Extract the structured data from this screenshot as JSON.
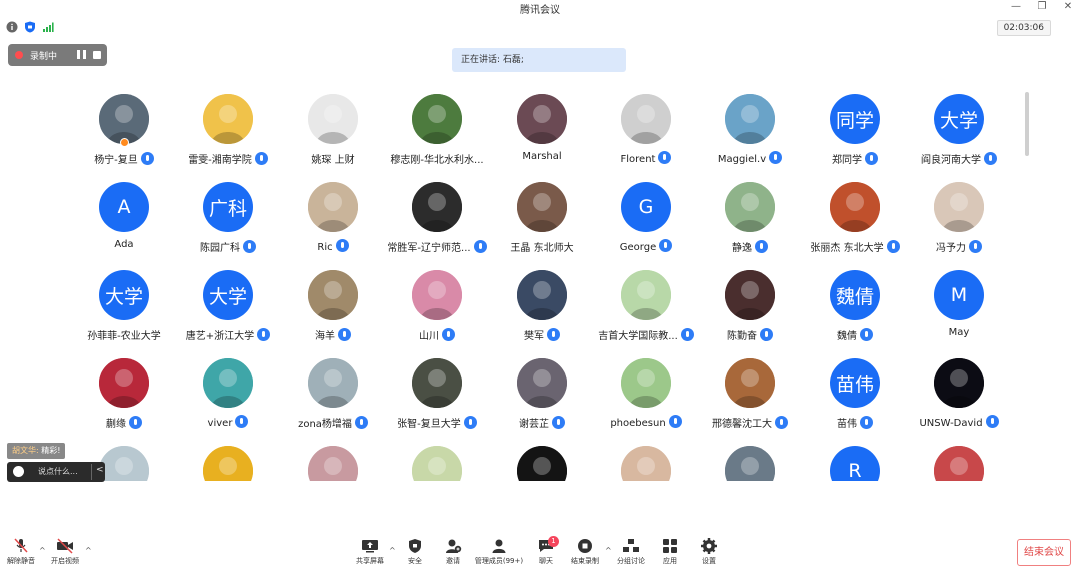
{
  "window": {
    "title": "腾讯会议"
  },
  "status": {
    "timer": "02:03:06"
  },
  "recording": {
    "label": "录制中"
  },
  "speaking": {
    "text": "正在讲话: 石磊;"
  },
  "participants": [
    {
      "name": "杨宁-复旦",
      "type": "photo",
      "color": "#5a6a78",
      "mic": true,
      "host": true
    },
    {
      "name": "雷雯-湘南学院",
      "type": "photo",
      "color": "#f0c24a",
      "mic": true
    },
    {
      "name": "姚琛 上财",
      "type": "photo",
      "color": "#e8e8e8",
      "mic": false
    },
    {
      "name": "穆志刚-华北水利水...",
      "type": "photo",
      "color": "#4d7b3e",
      "mic": false
    },
    {
      "name": "Marshal",
      "type": "photo",
      "color": "#6b4a54",
      "mic": false
    },
    {
      "name": "Florent",
      "type": "photo",
      "color": "#cfcfcf",
      "mic": true
    },
    {
      "name": "Maggiel.v",
      "type": "photo",
      "color": "#6aa3c8",
      "mic": true
    },
    {
      "name": "郑同学",
      "type": "initials",
      "initials": "同学",
      "mic": true
    },
    {
      "name": "阎良河南大学",
      "type": "initials",
      "initials": "大学",
      "mic": true
    },
    {
      "name": "Ada",
      "type": "initials",
      "initials": "A",
      "mic": false
    },
    {
      "name": "陈园广科",
      "type": "initials",
      "initials": "广科",
      "mic": true
    },
    {
      "name": "Ric",
      "type": "photo",
      "color": "#c9b49a",
      "mic": true
    },
    {
      "name": "常胜军-辽宁师范...",
      "type": "photo",
      "color": "#2c2c2c",
      "mic": true
    },
    {
      "name": "王晶 东北师大",
      "type": "photo",
      "color": "#7a5a4a",
      "mic": false
    },
    {
      "name": "George",
      "type": "initials",
      "initials": "G",
      "mic": true
    },
    {
      "name": "静逸",
      "type": "photo",
      "color": "#8fb38a",
      "mic": true
    },
    {
      "name": "张丽杰 东北大学",
      "type": "photo",
      "color": "#c0502c",
      "mic": true
    },
    {
      "name": "冯予力",
      "type": "photo",
      "color": "#d9c7b8",
      "mic": true
    },
    {
      "name": "孙菲菲-农业大学",
      "type": "initials",
      "initials": "大学",
      "mic": false
    },
    {
      "name": "唐艺+浙江大学",
      "type": "initials",
      "initials": "大学",
      "mic": true
    },
    {
      "name": "海羊",
      "type": "photo",
      "color": "#a08a6a",
      "mic": true
    },
    {
      "name": "山川",
      "type": "photo",
      "color": "#d98aa8",
      "mic": true
    },
    {
      "name": "樊军",
      "type": "photo",
      "color": "#3a4a64",
      "mic": true
    },
    {
      "name": "吉首大学国际教...",
      "type": "photo",
      "color": "#b8d8a8",
      "mic": true
    },
    {
      "name": "陈勤奋",
      "type": "photo",
      "color": "#4a2e2e",
      "mic": true
    },
    {
      "name": "魏倩",
      "type": "initials",
      "initials": "魏倩",
      "mic": true
    },
    {
      "name": "May",
      "type": "initials",
      "initials": "M",
      "mic": false
    },
    {
      "name": "蒯缘",
      "type": "photo",
      "color": "#b8283a",
      "mic": true
    },
    {
      "name": "viver",
      "type": "photo",
      "color": "#3fa6a8",
      "mic": true
    },
    {
      "name": "zona杨增福",
      "type": "photo",
      "color": "#9fb0b8",
      "mic": true
    },
    {
      "name": "张智-复旦大学",
      "type": "photo",
      "color": "#4a4f44",
      "mic": true
    },
    {
      "name": "谢芸芷",
      "type": "photo",
      "color": "#6a6470",
      "mic": true
    },
    {
      "name": "phoebesun",
      "type": "photo",
      "color": "#9cc88a",
      "mic": true
    },
    {
      "name": "邢德馨沈工大",
      "type": "photo",
      "color": "#a8683a",
      "mic": true
    },
    {
      "name": "苗伟",
      "type": "initials",
      "initials": "苗伟",
      "mic": true
    },
    {
      "name": "UNSW-David",
      "type": "photo",
      "color": "#0c0c14",
      "mic": true
    },
    {
      "name": "",
      "type": "photo",
      "color": "#b8c8d0",
      "mic": false
    },
    {
      "name": "",
      "type": "photo",
      "color": "#e8b020",
      "mic": false
    },
    {
      "name": "",
      "type": "photo",
      "color": "#c89aa0",
      "mic": false
    },
    {
      "name": "",
      "type": "photo",
      "color": "#c8d8a8",
      "mic": false
    },
    {
      "name": "",
      "type": "photo",
      "color": "#141414",
      "mic": false
    },
    {
      "name": "",
      "type": "photo",
      "color": "#d8b8a0",
      "mic": false
    },
    {
      "name": "",
      "type": "photo",
      "color": "#6a7a88",
      "mic": false
    },
    {
      "name": "",
      "type": "initials",
      "initials": "R",
      "mic": false
    },
    {
      "name": "",
      "type": "photo",
      "color": "#c8484a",
      "mic": false
    }
  ],
  "chat": {
    "sender": "胡文华:",
    "message": "精彩!",
    "placeholder": "说点什么..."
  },
  "toolbar": {
    "unmute": "解除静音",
    "start_video": "开启视频",
    "share": "共享屏幕",
    "security": "安全",
    "invite": "邀请",
    "members": "管理成员(99+)",
    "chat": "聊天",
    "chat_badge": "1",
    "end_record": "结束录制",
    "breakout": "分组讨论",
    "apps": "应用",
    "settings": "设置",
    "end_meeting": "结束会议"
  }
}
